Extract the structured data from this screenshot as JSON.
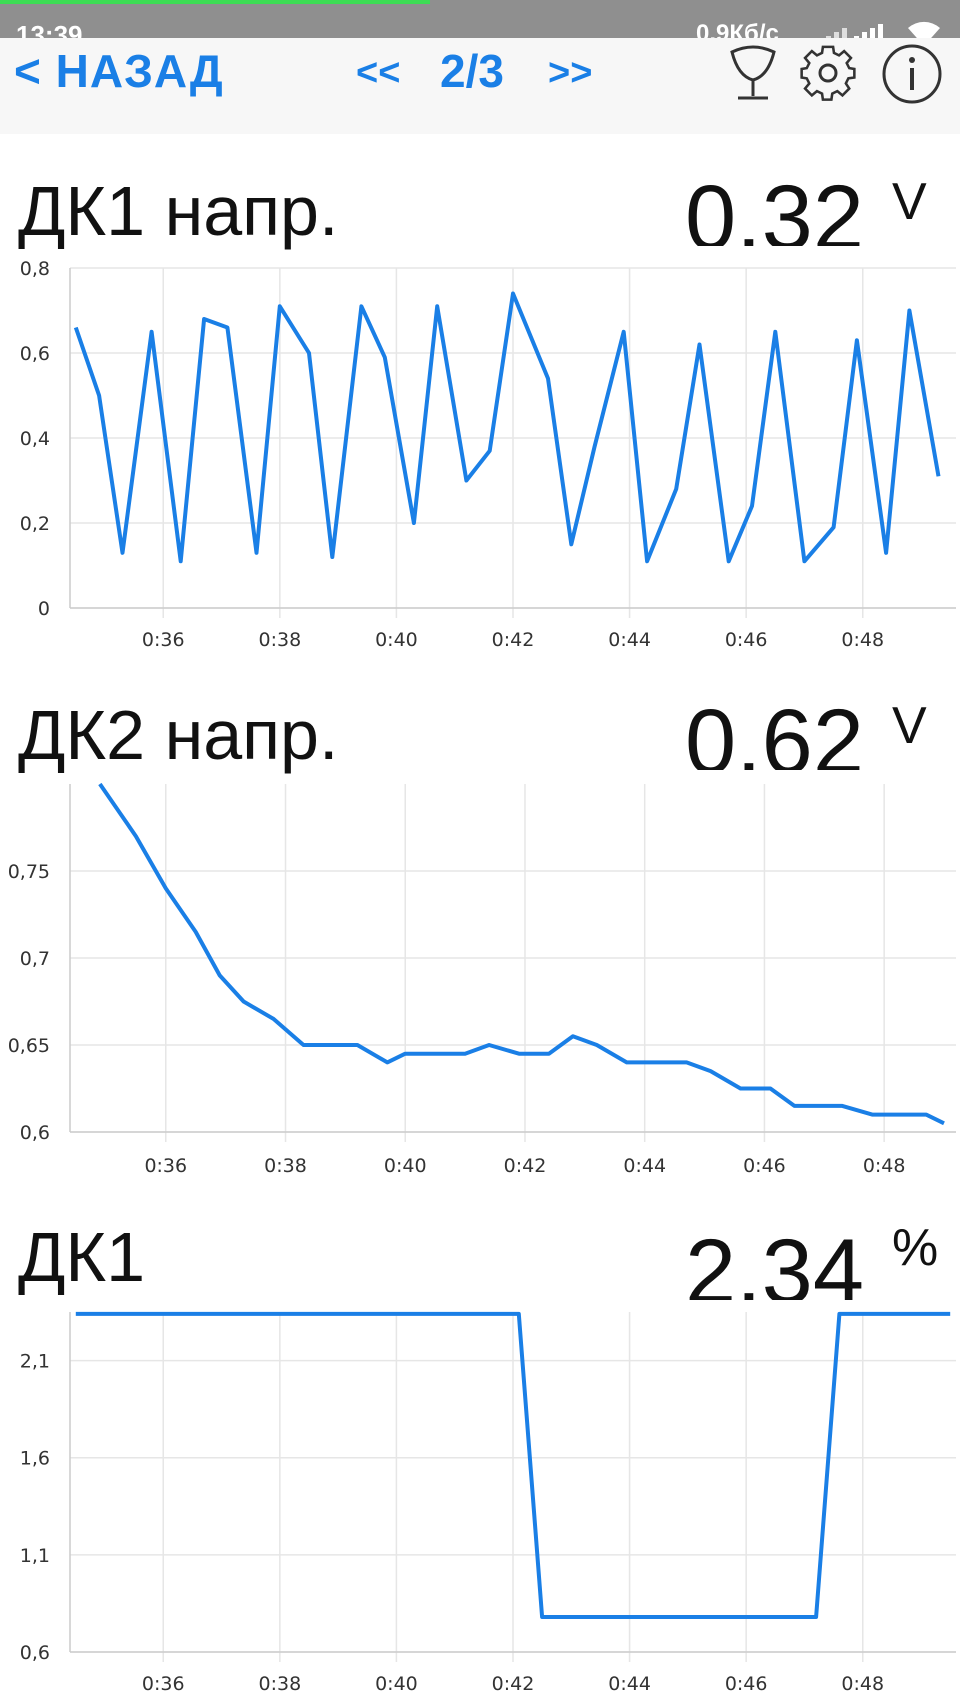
{
  "status": {
    "time": "13:39",
    "speed": "0,9Кб/с"
  },
  "nav": {
    "back": "< НАЗАД",
    "prev": "<<",
    "page": "2/3",
    "next": ">>"
  },
  "icons": [
    "lambda-probe-icon",
    "gear-icon",
    "info-icon"
  ],
  "colors": {
    "accent": "#1a7fe6",
    "line": "#1a7fe6",
    "grid": "#e6e6e6"
  },
  "panels": [
    {
      "title": "ДК1 напр.",
      "value": "0.32",
      "unit": "V"
    },
    {
      "title": "ДК2 напр.",
      "value": "0.62",
      "unit": "V"
    },
    {
      "title": "ДК1",
      "value": "2.34",
      "unit": "%"
    }
  ],
  "chart_data": [
    {
      "type": "line",
      "title": "",
      "x_ticks": [
        "0:36",
        "0:38",
        "0:40",
        "0:42",
        "0:44",
        "0:46",
        "0:48"
      ],
      "y_ticks": [
        "0",
        "0,2",
        "0,4",
        "0,6",
        "0,8"
      ],
      "ylim": [
        0,
        0.8
      ],
      "grid": true,
      "x": [
        34.5,
        34.9,
        35.3,
        35.8,
        36.3,
        36.7,
        37.1,
        37.6,
        38.0,
        38.5,
        38.9,
        39.4,
        39.8,
        40.3,
        40.7,
        41.2,
        41.6,
        42.0,
        42.6,
        43.0,
        43.4,
        43.9,
        44.3,
        44.8,
        45.2,
        45.7,
        46.1,
        46.5,
        47.0,
        47.5,
        47.9,
        48.4,
        48.8,
        49.3
      ],
      "values": [
        0.66,
        0.5,
        0.13,
        0.65,
        0.11,
        0.68,
        0.66,
        0.13,
        0.71,
        0.6,
        0.12,
        0.71,
        0.59,
        0.2,
        0.71,
        0.3,
        0.37,
        0.74,
        0.54,
        0.15,
        0.38,
        0.65,
        0.11,
        0.28,
        0.62,
        0.11,
        0.24,
        0.65,
        0.11,
        0.19,
        0.63,
        0.13,
        0.7,
        0.31
      ]
    },
    {
      "type": "line",
      "title": "",
      "x_ticks": [
        "0:36",
        "0:38",
        "0:40",
        "0:42",
        "0:44",
        "0:46",
        "0:48"
      ],
      "y_ticks": [
        "0,6",
        "0,65",
        "0,7",
        "0,75"
      ],
      "ylim": [
        0.6,
        0.8
      ],
      "grid": true,
      "x": [
        34.9,
        35.5,
        36.0,
        36.5,
        36.9,
        37.3,
        37.8,
        38.3,
        38.7,
        39.2,
        39.7,
        40.0,
        40.5,
        41.0,
        41.4,
        41.9,
        42.4,
        42.8,
        43.2,
        43.7,
        44.2,
        44.7,
        45.1,
        45.6,
        46.1,
        46.5,
        47.0,
        47.3,
        47.8,
        48.3,
        48.7,
        49.0
      ],
      "values": [
        0.8,
        0.77,
        0.74,
        0.715,
        0.69,
        0.675,
        0.665,
        0.65,
        0.65,
        0.65,
        0.64,
        0.645,
        0.645,
        0.645,
        0.65,
        0.645,
        0.645,
        0.655,
        0.65,
        0.64,
        0.64,
        0.64,
        0.635,
        0.625,
        0.625,
        0.615,
        0.615,
        0.615,
        0.61,
        0.61,
        0.61,
        0.605
      ]
    },
    {
      "type": "line",
      "title": "",
      "x_ticks": [
        "0:36",
        "0:38",
        "0:40",
        "0:42",
        "0:44",
        "0:46",
        "0:48"
      ],
      "y_ticks": [
        "0,6",
        "1,1",
        "1,6",
        "2,1"
      ],
      "ylim": [
        0.6,
        2.35
      ],
      "grid": true,
      "x": [
        34.5,
        42.1,
        42.5,
        47.2,
        47.6,
        49.5
      ],
      "values": [
        2.34,
        2.34,
        0.78,
        0.78,
        2.34,
        2.34
      ]
    }
  ]
}
